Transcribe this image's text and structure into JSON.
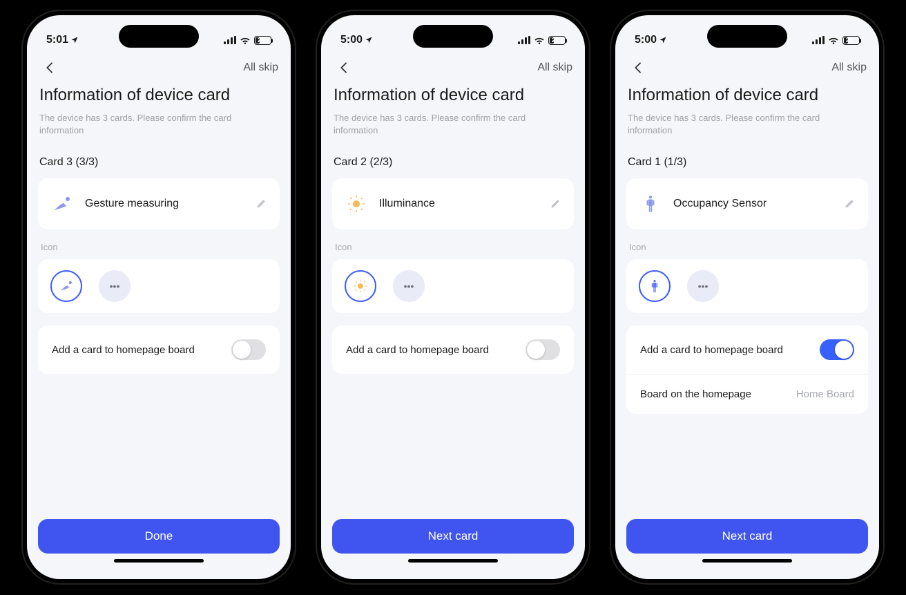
{
  "screens": [
    {
      "status": {
        "time": "5:01",
        "battery_percent": "29"
      },
      "nav": {
        "skip_label": "All skip"
      },
      "header": {
        "title": "Information of device card",
        "subtitle": "The device has 3 cards. Please confirm the card information"
      },
      "card_label": "Card 3 (3/3)",
      "device": {
        "name": "Gesture measuring",
        "icon": "gesture-icon"
      },
      "icon_section_label": "Icon",
      "settings": {
        "add_label": "Add a card to homepage board",
        "add_enabled": false
      },
      "primary_label": "Done"
    },
    {
      "status": {
        "time": "5:00",
        "battery_percent": "29"
      },
      "nav": {
        "skip_label": "All skip"
      },
      "header": {
        "title": "Information of device card",
        "subtitle": "The device has 3 cards. Please confirm the card information"
      },
      "card_label": "Card 2 (2/3)",
      "device": {
        "name": "Illuminance",
        "icon": "sun-icon"
      },
      "icon_section_label": "Icon",
      "settings": {
        "add_label": "Add a card to homepage board",
        "add_enabled": false
      },
      "primary_label": "Next card"
    },
    {
      "status": {
        "time": "5:00",
        "battery_percent": "29"
      },
      "nav": {
        "skip_label": "All skip"
      },
      "header": {
        "title": "Information of device card",
        "subtitle": "The device has 3 cards. Please confirm the card information"
      },
      "card_label": "Card 1 (1/3)",
      "device": {
        "name": "Occupancy Sensor",
        "icon": "person-icon"
      },
      "icon_section_label": "Icon",
      "settings": {
        "add_label": "Add a card to homepage board",
        "add_enabled": true,
        "board_label": "Board on the homepage",
        "board_value": "Home Board"
      },
      "primary_label": "Next card"
    }
  ]
}
